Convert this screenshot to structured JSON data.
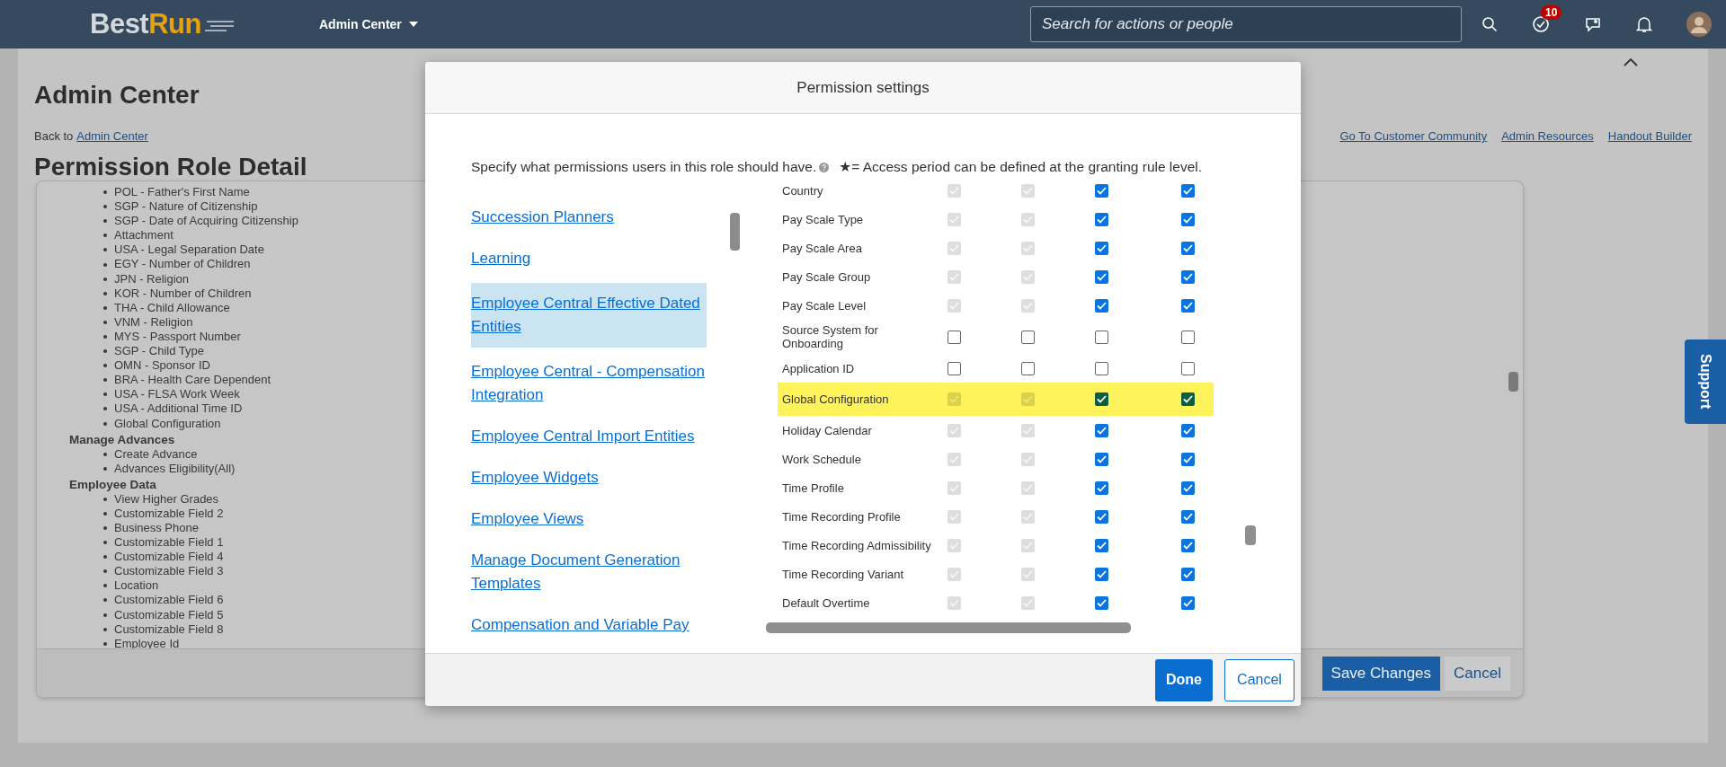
{
  "top_bar": {
    "logo_first": "Best",
    "logo_second": "Run",
    "menu": "Admin Center",
    "search": {
      "placeholder": "Search for actions or people"
    },
    "notification_count": "10"
  },
  "page": {
    "title": "Admin Center",
    "breadcrumb_prefix": "Back to",
    "breadcrumb_link": "Admin Center",
    "links": [
      "Go To Customer Community",
      "Admin Resources",
      "Handout Builder"
    ],
    "subtitle": "Permission Role Detail",
    "sections": [
      {
        "items": [
          "POL - Father's First Name",
          "SGP - Nature of Citizenship",
          "SGP - Date of Acquiring Citizenship",
          "Attachment",
          "USA - Legal Separation Date",
          "EGY - Number of Children",
          "JPN - Religion",
          "KOR - Number of Children",
          "THA - Child Allowance",
          "VNM - Religion",
          "MYS - Passport Number",
          "SGP - Child Type",
          "OMN - Sponsor ID",
          "BRA - Health Care Dependent",
          "USA - FLSA Work Week",
          "USA - Additional Time ID",
          "Global Configuration"
        ]
      },
      {
        "heading": "Manage Advances",
        "items": [
          "Create Advance",
          "Advances Eligibility(All)"
        ]
      },
      {
        "heading": "Employee Data",
        "items": [
          "View Higher Grades",
          "Customizable Field 2",
          "Business Phone",
          "Customizable Field 1",
          "Customizable Field 4",
          "Customizable Field 3",
          "Location",
          "Customizable Field 6",
          "Customizable Field 5",
          "Customizable Field 8",
          "Employee Id"
        ]
      }
    ],
    "buttons": [
      {
        "label": "Save Changes",
        "kind": "primary"
      },
      {
        "label": "Cancel",
        "kind": "secondary"
      }
    ]
  },
  "support_tab": "Support",
  "dialog": {
    "title": "Permission settings",
    "description": "Specify what permissions users in this role should have.",
    "note": "★= Access period can be defined at the granting rule level.",
    "categories": [
      {
        "label": "Succession Planners",
        "selected": false
      },
      {
        "label": "Learning",
        "selected": false
      },
      {
        "label": "Employee Central Effective Dated Entities",
        "selected": true
      },
      {
        "label": "Employee Central - Compensation Integration",
        "selected": false
      },
      {
        "label": "Employee Central Import Entities",
        "selected": false
      },
      {
        "label": "Employee Widgets",
        "selected": false
      },
      {
        "label": "Employee Views",
        "selected": false
      },
      {
        "label": "Manage Document Generation Templates",
        "selected": false
      },
      {
        "label": "Compensation and Variable Pay",
        "selected": false
      }
    ],
    "permissions": [
      {
        "name": "Country",
        "highlighted": false,
        "checks": [
          {
            "checked": true,
            "disabled": true
          },
          {
            "checked": true,
            "disabled": true
          },
          {
            "checked": true,
            "disabled": false
          },
          {
            "checked": true,
            "disabled": false
          }
        ]
      },
      {
        "name": "Pay Scale Type",
        "highlighted": false,
        "checks": [
          {
            "checked": true,
            "disabled": true
          },
          {
            "checked": true,
            "disabled": true
          },
          {
            "checked": true,
            "disabled": false
          },
          {
            "checked": true,
            "disabled": false
          }
        ]
      },
      {
        "name": "Pay Scale Area",
        "highlighted": false,
        "checks": [
          {
            "checked": true,
            "disabled": true
          },
          {
            "checked": true,
            "disabled": true
          },
          {
            "checked": true,
            "disabled": false
          },
          {
            "checked": true,
            "disabled": false
          }
        ]
      },
      {
        "name": "Pay Scale Group",
        "highlighted": false,
        "checks": [
          {
            "checked": true,
            "disabled": true
          },
          {
            "checked": true,
            "disabled": true
          },
          {
            "checked": true,
            "disabled": false
          },
          {
            "checked": true,
            "disabled": false
          }
        ]
      },
      {
        "name": "Pay Scale Level",
        "highlighted": false,
        "checks": [
          {
            "checked": true,
            "disabled": true
          },
          {
            "checked": true,
            "disabled": true
          },
          {
            "checked": true,
            "disabled": false
          },
          {
            "checked": true,
            "disabled": false
          }
        ]
      },
      {
        "name": "Source System for Onboarding",
        "highlighted": false,
        "checks": [
          {
            "checked": false,
            "disabled": false
          },
          {
            "checked": false,
            "disabled": false
          },
          {
            "checked": false,
            "disabled": false
          },
          {
            "checked": false,
            "disabled": false
          }
        ]
      },
      {
        "name": "Application ID",
        "highlighted": false,
        "checks": [
          {
            "checked": false,
            "disabled": false
          },
          {
            "checked": false,
            "disabled": false
          },
          {
            "checked": false,
            "disabled": false
          },
          {
            "checked": false,
            "disabled": false
          }
        ]
      },
      {
        "name": "Global Configuration",
        "highlighted": true,
        "checks": [
          {
            "checked": true,
            "disabled": true
          },
          {
            "checked": true,
            "disabled": true
          },
          {
            "checked": true,
            "disabled": false
          },
          {
            "checked": true,
            "disabled": false
          }
        ]
      },
      {
        "name": "Holiday Calendar",
        "highlighted": false,
        "checks": [
          {
            "checked": true,
            "disabled": true
          },
          {
            "checked": true,
            "disabled": true
          },
          {
            "checked": true,
            "disabled": false
          },
          {
            "checked": true,
            "disabled": false
          }
        ]
      },
      {
        "name": "Work Schedule",
        "highlighted": false,
        "checks": [
          {
            "checked": true,
            "disabled": true
          },
          {
            "checked": true,
            "disabled": true
          },
          {
            "checked": true,
            "disabled": false
          },
          {
            "checked": true,
            "disabled": false
          }
        ]
      },
      {
        "name": "Time Profile",
        "highlighted": false,
        "checks": [
          {
            "checked": true,
            "disabled": true
          },
          {
            "checked": true,
            "disabled": true
          },
          {
            "checked": true,
            "disabled": false
          },
          {
            "checked": true,
            "disabled": false
          }
        ]
      },
      {
        "name": "Time Recording Profile",
        "highlighted": false,
        "checks": [
          {
            "checked": true,
            "disabled": true
          },
          {
            "checked": true,
            "disabled": true
          },
          {
            "checked": true,
            "disabled": false
          },
          {
            "checked": true,
            "disabled": false
          }
        ]
      },
      {
        "name": "Time Recording Admissibility",
        "highlighted": false,
        "checks": [
          {
            "checked": true,
            "disabled": true
          },
          {
            "checked": true,
            "disabled": true
          },
          {
            "checked": true,
            "disabled": false
          },
          {
            "checked": true,
            "disabled": false
          }
        ]
      },
      {
        "name": "Time Recording Variant",
        "highlighted": false,
        "checks": [
          {
            "checked": true,
            "disabled": true
          },
          {
            "checked": true,
            "disabled": true
          },
          {
            "checked": true,
            "disabled": false
          },
          {
            "checked": true,
            "disabled": false
          }
        ]
      },
      {
        "name": "Default Overtime",
        "highlighted": false,
        "checks": [
          {
            "checked": true,
            "disabled": true
          },
          {
            "checked": true,
            "disabled": true
          },
          {
            "checked": true,
            "disabled": false
          },
          {
            "checked": true,
            "disabled": false
          }
        ]
      }
    ],
    "buttons": [
      {
        "label": "Done",
        "kind": "primary"
      },
      {
        "label": "Cancel",
        "kind": "secondary"
      }
    ]
  }
}
